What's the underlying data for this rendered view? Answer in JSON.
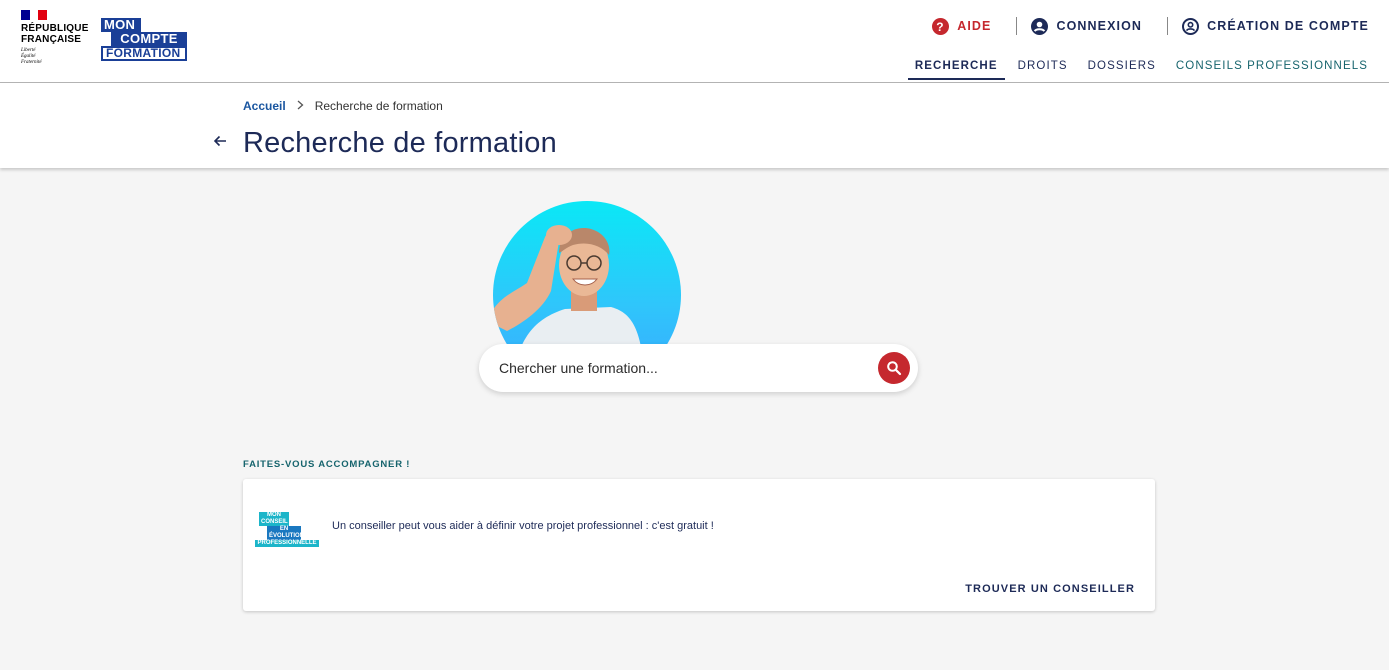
{
  "header": {
    "rf": {
      "name_line1": "RÉPUBLIQUE",
      "name_line2": "FRANÇAISE",
      "motto_line1": "Liberté",
      "motto_line2": "Égalité",
      "motto_line3": "Fraternité"
    },
    "mcf": {
      "line1": "MON",
      "line2": "COMPTE",
      "line3": "FORMATION"
    },
    "top_links": {
      "aide": "AIDE",
      "connexion": "CONNEXION",
      "creation": "CRÉATION DE COMPTE"
    },
    "nav": {
      "recherche": "RECHERCHE",
      "droits": "DROITS",
      "dossiers": "DOSSIERS",
      "conseils": "CONSEILS PROFESSIONNELS"
    }
  },
  "breadcrumb": {
    "home": "Accueil",
    "current": "Recherche de formation"
  },
  "page_title": "Recherche de formation",
  "search": {
    "placeholder": "Chercher une formation..."
  },
  "accompagnement": {
    "label": "FAITES-VOUS ACCOMPAGNER !",
    "logo_line1": "MON CONSEIL",
    "logo_line2": "EN ÉVOLUTION",
    "logo_line3": "PROFESSIONNELLE",
    "text": "Un conseiller peut vous aider à définir votre projet professionnel : c'est gratuit !",
    "action": "TROUVER UN CONSEILLER"
  },
  "colors": {
    "brand_blue": "#1d2a57",
    "alert_red": "#c5282e",
    "teal": "#16646d",
    "hero_gradient_top": "#0ae8f6",
    "hero_gradient_bottom": "#3aa8ff"
  }
}
